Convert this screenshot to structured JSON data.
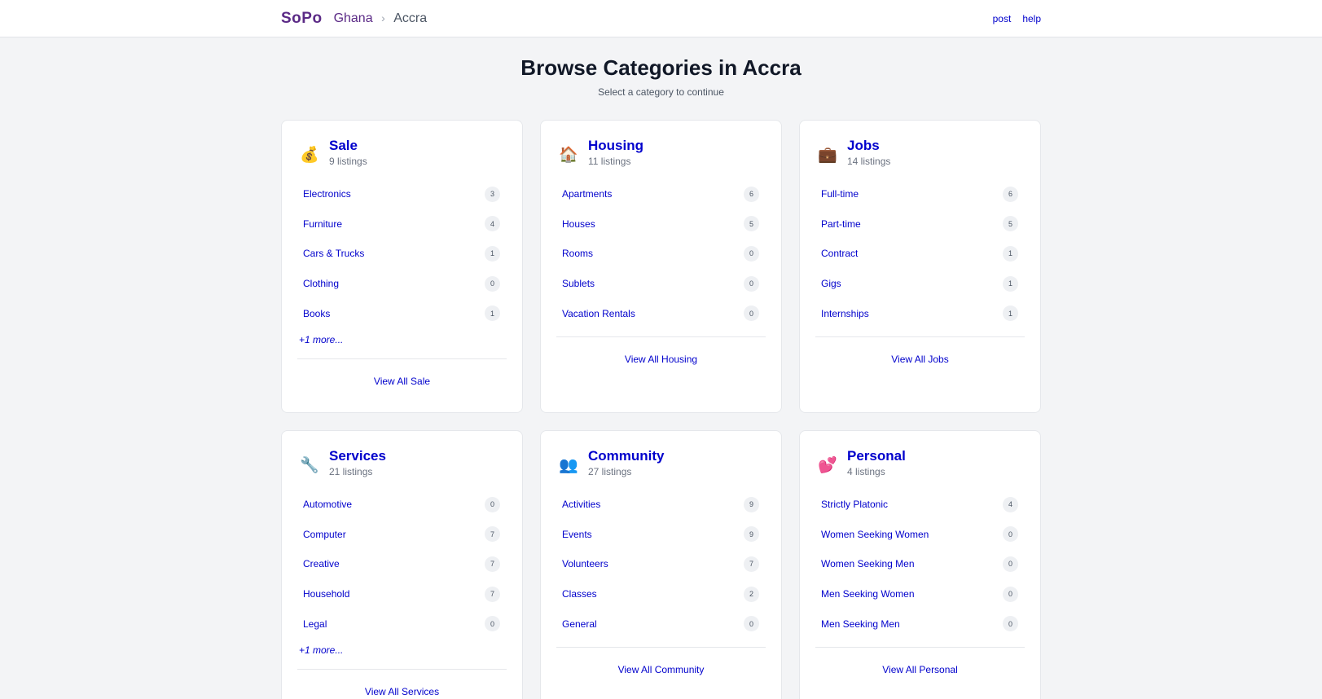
{
  "header": {
    "logo": "SoPo",
    "country": "Ghana",
    "separator": "›",
    "city": "Accra",
    "nav": {
      "post": "post",
      "help": "help"
    }
  },
  "page": {
    "title": "Browse Categories in Accra",
    "subtitle": "Select a category to continue"
  },
  "categories": [
    {
      "icon": "money-bag-icon",
      "glyph": "💰",
      "name": "Sale",
      "count": "9 listings",
      "subs": [
        {
          "label": "Electronics",
          "count": "3"
        },
        {
          "label": "Furniture",
          "count": "4"
        },
        {
          "label": "Cars & Trucks",
          "count": "1"
        },
        {
          "label": "Clothing",
          "count": "0"
        },
        {
          "label": "Books",
          "count": "1"
        }
      ],
      "more": "+1 more...",
      "view_all": "View All Sale"
    },
    {
      "icon": "house-icon",
      "glyph": "🏠",
      "name": "Housing",
      "count": "11 listings",
      "subs": [
        {
          "label": "Apartments",
          "count": "6"
        },
        {
          "label": "Houses",
          "count": "5"
        },
        {
          "label": "Rooms",
          "count": "0"
        },
        {
          "label": "Sublets",
          "count": "0"
        },
        {
          "label": "Vacation Rentals",
          "count": "0"
        }
      ],
      "view_all": "View All Housing"
    },
    {
      "icon": "briefcase-icon",
      "glyph": "💼",
      "name": "Jobs",
      "count": "14 listings",
      "subs": [
        {
          "label": "Full-time",
          "count": "6"
        },
        {
          "label": "Part-time",
          "count": "5"
        },
        {
          "label": "Contract",
          "count": "1"
        },
        {
          "label": "Gigs",
          "count": "1"
        },
        {
          "label": "Internships",
          "count": "1"
        }
      ],
      "view_all": "View All Jobs"
    },
    {
      "icon": "wrench-icon",
      "glyph": "🔧",
      "name": "Services",
      "count": "21 listings",
      "subs": [
        {
          "label": "Automotive",
          "count": "0"
        },
        {
          "label": "Computer",
          "count": "7"
        },
        {
          "label": "Creative",
          "count": "7"
        },
        {
          "label": "Household",
          "count": "7"
        },
        {
          "label": "Legal",
          "count": "0"
        }
      ],
      "more": "+1 more...",
      "view_all": "View All Services"
    },
    {
      "icon": "people-icon",
      "glyph": "👥",
      "name": "Community",
      "count": "27 listings",
      "subs": [
        {
          "label": "Activities",
          "count": "9"
        },
        {
          "label": "Events",
          "count": "9"
        },
        {
          "label": "Volunteers",
          "count": "7"
        },
        {
          "label": "Classes",
          "count": "2"
        },
        {
          "label": "General",
          "count": "0"
        }
      ],
      "view_all": "View All Community"
    },
    {
      "icon": "two-hearts-icon",
      "glyph": "💕",
      "name": "Personal",
      "count": "4 listings",
      "subs": [
        {
          "label": "Strictly Platonic",
          "count": "4"
        },
        {
          "label": "Women Seeking Women",
          "count": "0"
        },
        {
          "label": "Women Seeking Men",
          "count": "0"
        },
        {
          "label": "Men Seeking Women",
          "count": "0"
        },
        {
          "label": "Men Seeking Men",
          "count": "0"
        }
      ],
      "view_all": "View All Personal"
    }
  ],
  "colors": {
    "brand": "#5b2a86",
    "link": "#0000cc",
    "background": "#f3f4f6"
  }
}
